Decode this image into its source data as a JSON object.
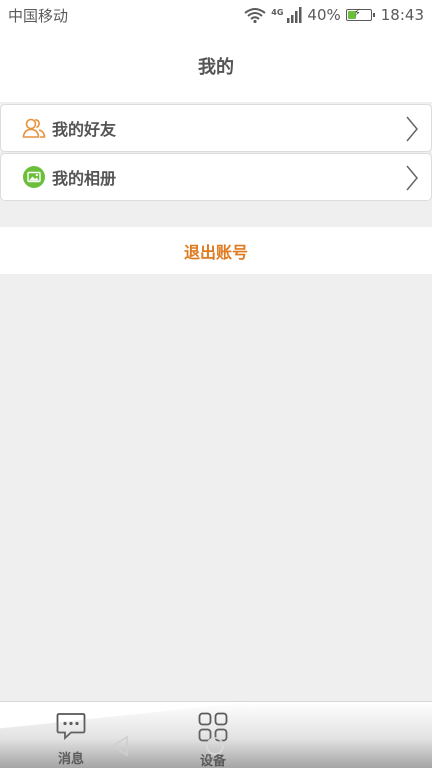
{
  "status_bar": {
    "carrier": "中国移动",
    "network": "4G",
    "battery_percent": "40%",
    "battery_level": 0.4,
    "time": "18:43",
    "icons": [
      "wifi-icon",
      "signal-icon",
      "battery-icon"
    ]
  },
  "header": {
    "title": "我的"
  },
  "menu": {
    "items": [
      {
        "label": "我的好友",
        "icon": "friends-icon"
      },
      {
        "label": "我的相册",
        "icon": "album-icon"
      }
    ]
  },
  "logout": {
    "label": "退出账号"
  },
  "tabbar": {
    "tabs": [
      {
        "label": "消息",
        "icon": "message-icon"
      },
      {
        "label": "设备",
        "icon": "grid-icon"
      }
    ]
  },
  "system_nav": {
    "icons": [
      "back-icon",
      "home-icon"
    ]
  },
  "colors": {
    "accent": "#e07a1f",
    "album_icon_bg": "#6bbf3a",
    "background": "#efefef"
  }
}
